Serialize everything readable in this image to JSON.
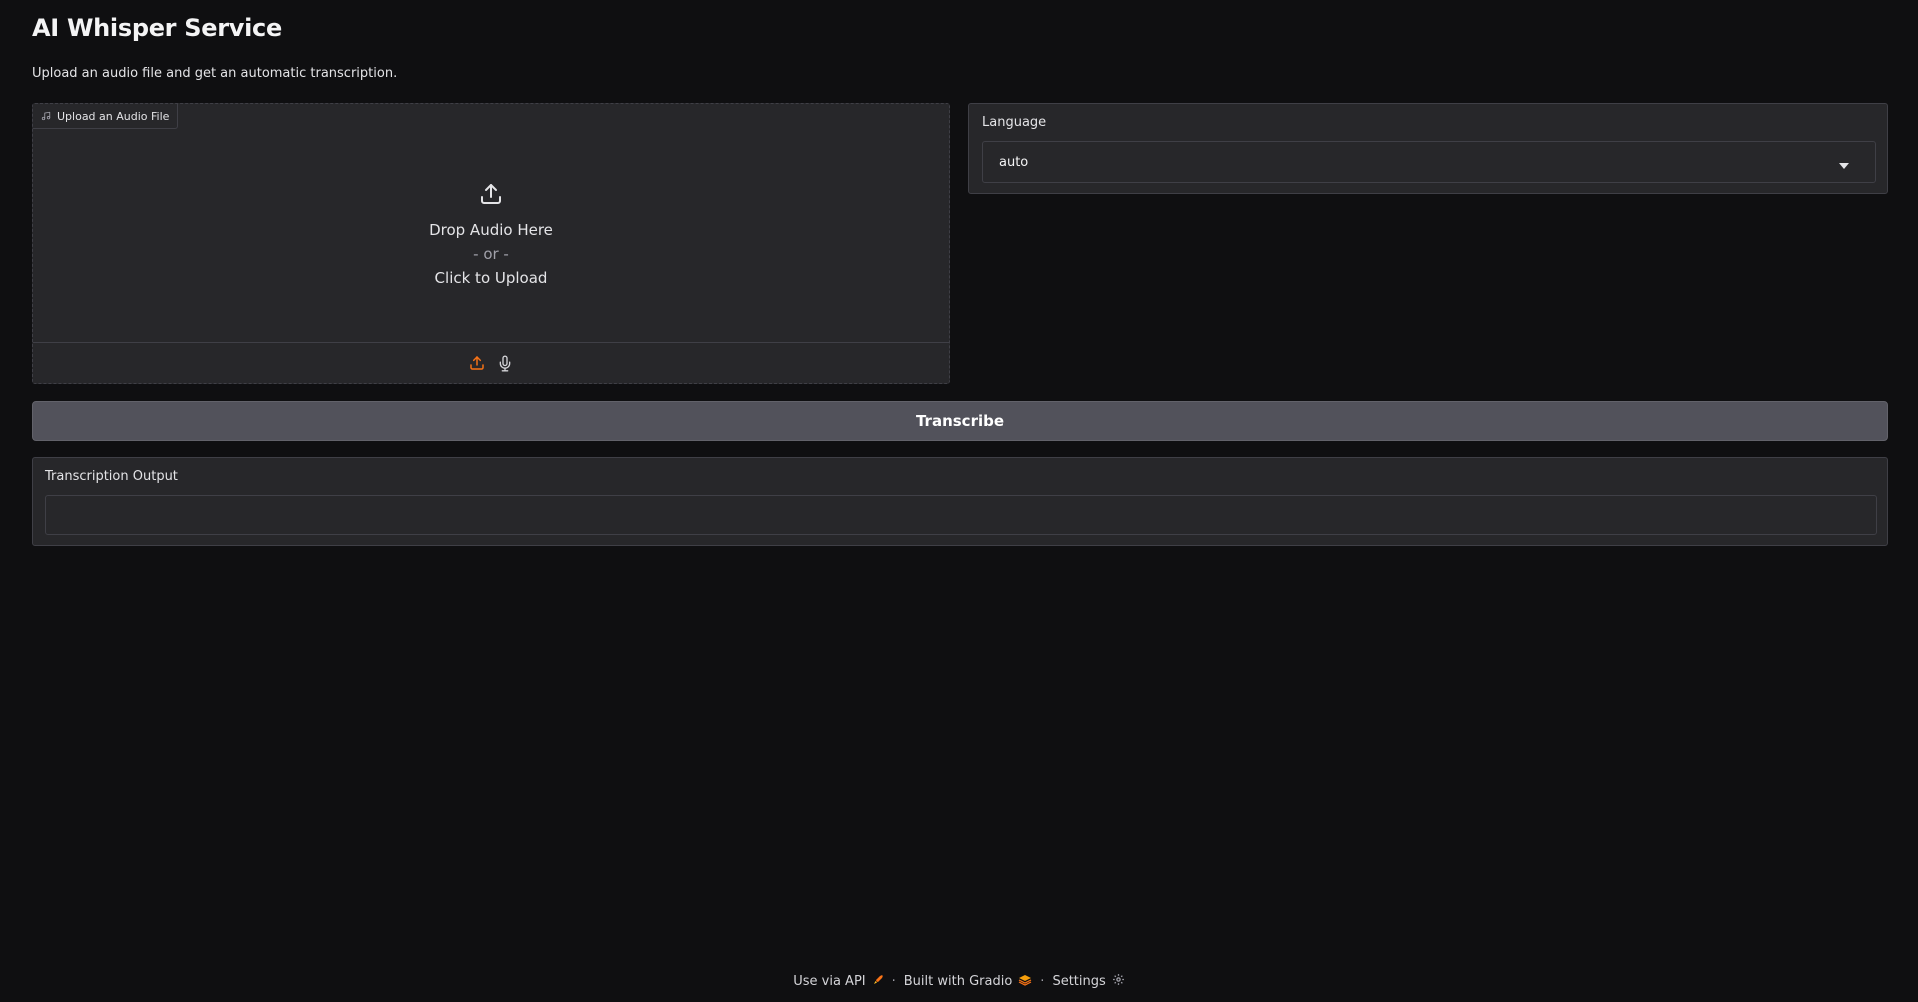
{
  "header": {
    "title": "AI Whisper Service",
    "description": "Upload an audio file and get an automatic transcription."
  },
  "audio_upload": {
    "label": "Upload an Audio File",
    "drop_text": "Drop Audio Here",
    "or_text": "- or -",
    "click_text": "Click to Upload",
    "label_icon": "music-note-icon",
    "toolbar_icons": [
      "upload-icon",
      "microphone-icon"
    ]
  },
  "language": {
    "label": "Language",
    "selected": "auto"
  },
  "transcribe_button": {
    "label": "Transcribe"
  },
  "output": {
    "label": "Transcription Output",
    "value": ""
  },
  "footer": {
    "api_label": "Use via API",
    "separator": "·",
    "gradio_label": "Built with Gradio",
    "settings_label": "Settings"
  },
  "colors": {
    "background": "#0f0f11",
    "panel": "#27272a",
    "border": "#3f3f46",
    "button": "#52525b",
    "accent": "#f97316"
  }
}
